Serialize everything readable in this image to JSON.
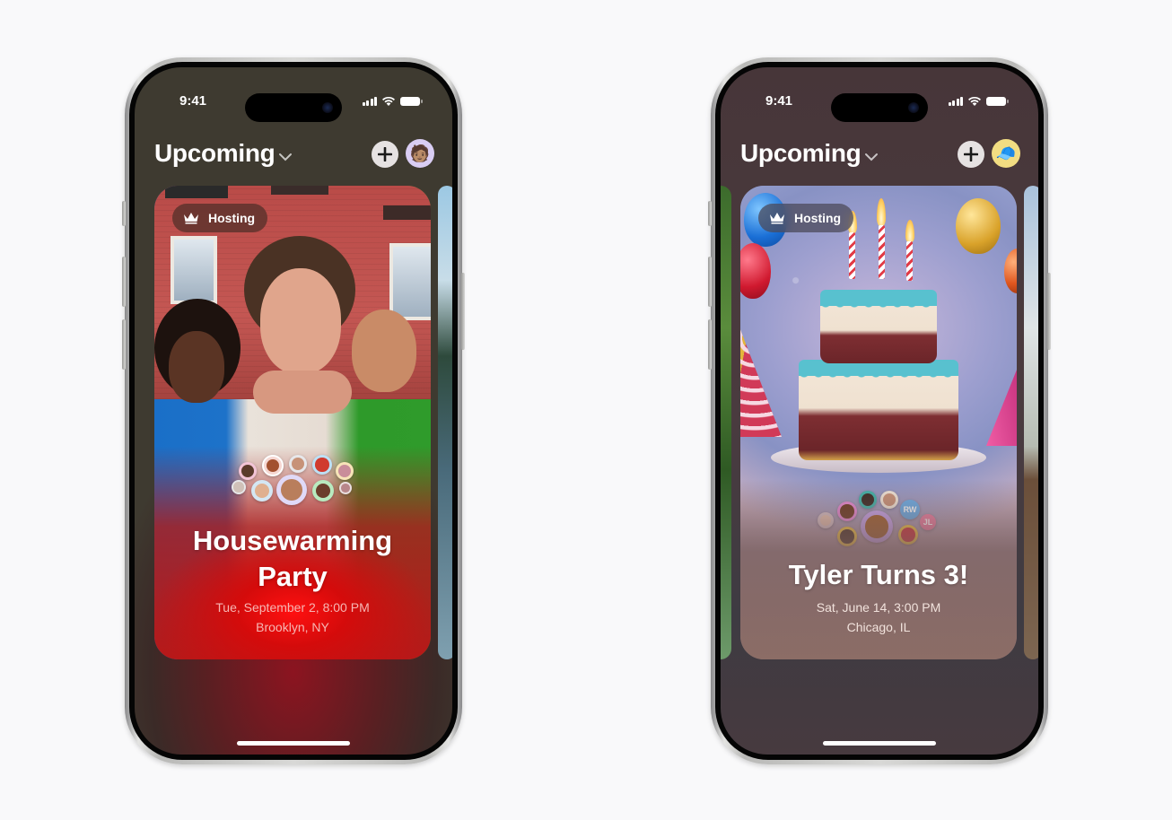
{
  "screens": [
    {
      "status": {
        "time": "9:41"
      },
      "header": {
        "title": "Upcoming",
        "add_label": "+",
        "avatar_emoji": "🧑🏽"
      },
      "event": {
        "badge": "Hosting",
        "title_line1": "Housewarming",
        "title_line2": "Party",
        "date": "Tue, September 2, 8:00 PM",
        "location": "Brooklyn, NY",
        "accent": "#e01010",
        "guests": [
          {
            "initials": "",
            "color": "#f3c4d6"
          },
          {
            "initials": "",
            "color": "#f6d7d2"
          },
          {
            "initials": "",
            "color": "#e7e7ea"
          },
          {
            "initials": "",
            "color": "#bde0f5"
          },
          {
            "initials": "",
            "color": "#f7e4b8"
          },
          {
            "initials": "",
            "color": "#e8e8ea"
          },
          {
            "initials": "",
            "color": "#d4e7f3"
          },
          {
            "initials": "",
            "color": "#e0d9f7"
          },
          {
            "initials": "",
            "color": "#b8eabf"
          },
          {
            "initials": "",
            "color": "#eadfdf"
          }
        ]
      }
    },
    {
      "status": {
        "time": "9:41"
      },
      "header": {
        "title": "Upcoming",
        "add_label": "+",
        "avatar_emoji": "🧢"
      },
      "event": {
        "badge": "Hosting",
        "title_line1": "Tyler Turns 3!",
        "date": "Sat, June 14, 3:00 PM",
        "location": "Chicago, IL",
        "accent": "#58c1cf",
        "guests": [
          {
            "initials": "",
            "color": "#3fb3a9"
          },
          {
            "initials": "",
            "color": "#f1e6d8"
          },
          {
            "initials": "",
            "color": "#e88bd6"
          },
          {
            "initials": "RW",
            "color": "#6aaee8"
          },
          {
            "initials": "",
            "color": "#d8c3c8"
          },
          {
            "initials": "",
            "color": "#c8a6ee"
          },
          {
            "initials": "JL",
            "color": "#ee7fa3"
          },
          {
            "initials": "",
            "color": "#f4c842"
          },
          {
            "initials": "",
            "color": "#f4c842"
          }
        ]
      }
    }
  ]
}
